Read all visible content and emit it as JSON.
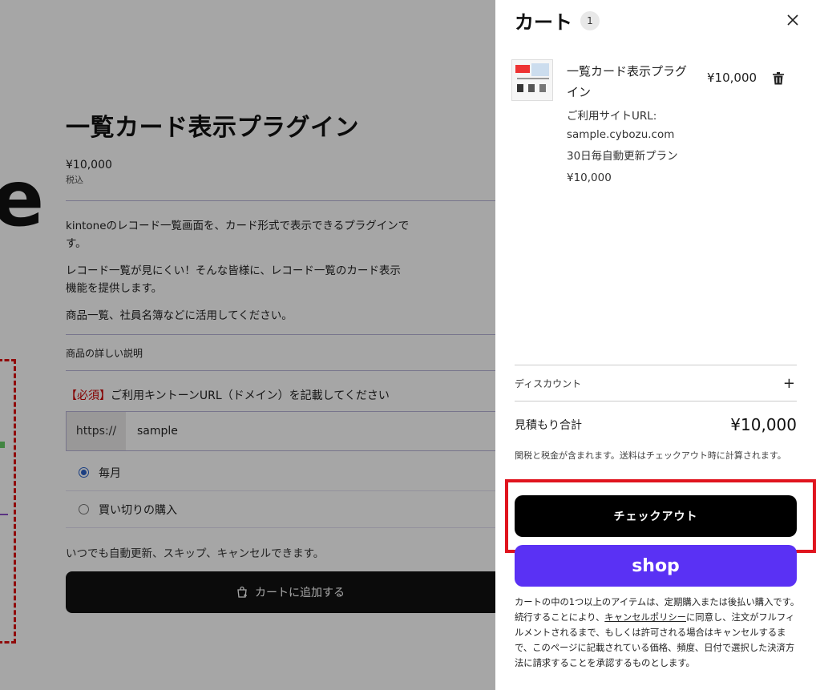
{
  "product": {
    "title": "一覧カード表示プラグイン",
    "price": "¥10,000",
    "tax_label": "税込",
    "description": [
      "kintoneのレコード一覧画面を、カード形式で表示できるプラグインです。",
      "レコード一覧が見にくい！そんな皆様に、レコード一覧のカード表示機能を提供します。",
      "商品一覧、社員名簿などに活用してください。"
    ],
    "detail_label": "商品の詳しい説明",
    "required_tag": "【必須】",
    "required_text": "ご利用キントーンURL（ドメイン）を記載してください",
    "url_prefix": "https://",
    "url_value": "sample",
    "options": [
      "毎月",
      "買い切りの購入"
    ],
    "note": "いつでも自動更新、スキップ、キャンセルできます。",
    "add_to_cart": "カートに追加する"
  },
  "cart": {
    "title": "カート",
    "count": "1",
    "item": {
      "name": "一覧カード表示プラグイン",
      "price": "¥10,000",
      "site_label": "ご利用サイトURL:",
      "site_value": "sample.cybozu.com",
      "plan": "30日毎自動更新プラン",
      "plan_price": "¥10,000"
    },
    "discount_label": "ディスカウント",
    "total_label": "見積もり合計",
    "total_value": "¥10,000",
    "tax_note": "関税と税金が含まれます。送料はチェックアウト時に計算されます。",
    "checkout_label": "チェックアウト",
    "shop_pay_label": "shop",
    "legal_1": "カートの中の1つ以上のアイテムは、定期購入または後払い購入です。続行することにより、",
    "legal_link": "キャンセルポリシー",
    "legal_2": "に同意し、注文がフルフィルメントされるまで、もしくは許可される場合はキャンセルするまで、このページに記載されている価格、頻度、日付で選択した決済方法に請求することを承認するものとします。"
  },
  "icons": {
    "close": "close-icon",
    "trash": "trash-icon",
    "plus": "plus-icon",
    "cart": "cart-plus-icon"
  },
  "colors": {
    "shop_pay": "#5a31f4",
    "highlight": "#e0141e",
    "checkout": "#000000"
  }
}
